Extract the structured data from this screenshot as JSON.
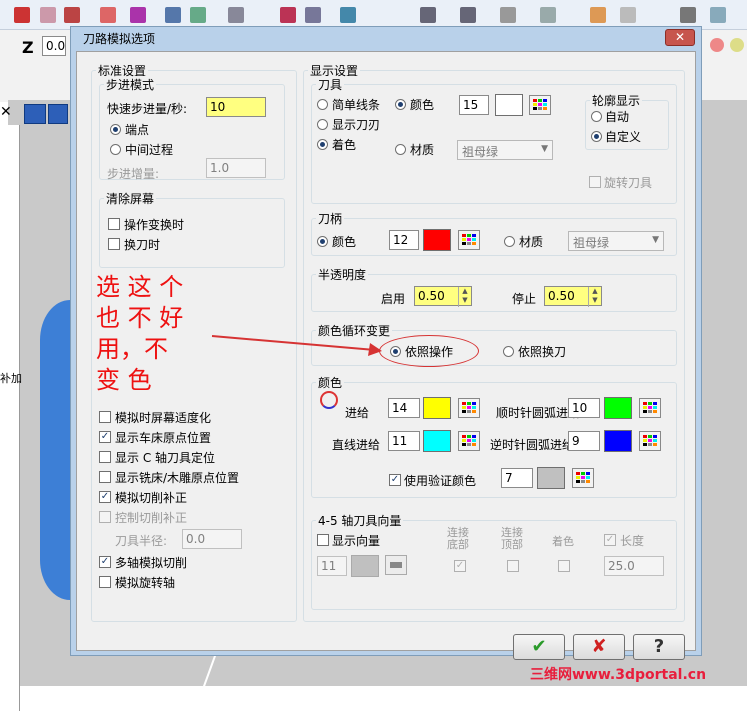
{
  "background": {
    "toolbar_z": "Z",
    "toolbar_value": "0.0",
    "side_text": "补加"
  },
  "dialog": {
    "title": "刀路模拟选项",
    "close": "✕",
    "standard": {
      "legend": "标准设置",
      "step_mode": {
        "legend": "步进模式",
        "rapid_label": "快速步进量/秒:",
        "rapid_value": "10",
        "endpoint": "端点",
        "midpoint": "中间过程",
        "increment_label": "步进增量:",
        "increment_value": "1.0"
      },
      "clear_screen": {
        "legend": "清除屏幕",
        "op_change": "操作变换时",
        "tool_change": "换刀时"
      },
      "options": [
        {
          "label": "模拟时屏幕适度化",
          "checked": false
        },
        {
          "label": "显示车床原点位置",
          "checked": true
        },
        {
          "label": "显示 C 轴刀具定位",
          "checked": false
        },
        {
          "label": "显示铣床/木雕原点位置",
          "checked": false
        },
        {
          "label": "模拟切削补正",
          "checked": true
        },
        {
          "label": "控制切削补正",
          "checked": false
        }
      ],
      "tool_radius_label": "刀具半径:",
      "tool_radius_value": "0.0",
      "multi_axis": "多轴模拟切削",
      "rotary": "模拟旋转轴"
    },
    "display": {
      "legend": "显示设置",
      "tool": {
        "legend": "刀具",
        "simple_lines": "简单线条",
        "show_holder": "显示刀刃",
        "shaded": "着色",
        "color": "颜色",
        "color_value": "15",
        "material": "材质",
        "material_value": "祖母绿",
        "outline": {
          "legend": "轮廓显示",
          "auto": "自动",
          "custom": "自定义"
        },
        "rotate_tool": "旋转刀具"
      },
      "holder": {
        "legend": "刀柄",
        "color": "颜色",
        "color_value": "12",
        "material": "材质",
        "material_value": "祖母绿"
      },
      "translucency": {
        "legend": "半透明度",
        "on_label": "启用",
        "on_value": "0.50",
        "off_label": "停止",
        "off_value": "0.50"
      },
      "color_cycle": {
        "legend": "颜色循环变更",
        "by_operation": "依照操作",
        "by_tool": "依照换刀"
      },
      "colors": {
        "legend": "颜色",
        "feed_label": "进给",
        "feed_value": "14",
        "cw_arc_label": "顺时针圆弧进给",
        "cw_arc_value": "10",
        "line_label": "直线进给",
        "line_value": "11",
        "ccw_arc_label": "逆时针圆弧进给",
        "ccw_arc_value": "9",
        "verify_label": "使用验证颜色",
        "verify_value": "7"
      },
      "axis45": {
        "legend": "4-5 轴刀具向量",
        "show_vectors": "显示向量",
        "value": "11",
        "connect_bottom": "连接\n底部",
        "connect_top": "连接\n顶部",
        "shade": "着色",
        "length": "长度",
        "length_value": "25.0"
      }
    },
    "buttons": {
      "ok": "✔",
      "cancel": "✘",
      "help": "?"
    }
  },
  "annotation": {
    "line1": "选 这 个",
    "line2": "也 不 好",
    "line3": "用，不",
    "line4": "变 色"
  },
  "watermark": "三维网www.3dportal.cn",
  "colors": {
    "red": "#ff0000",
    "yellow": "#ffff00",
    "cyan": "#00ffff",
    "green": "#00ff00",
    "blue": "#0000ff",
    "gray": "#c0c0c0"
  }
}
